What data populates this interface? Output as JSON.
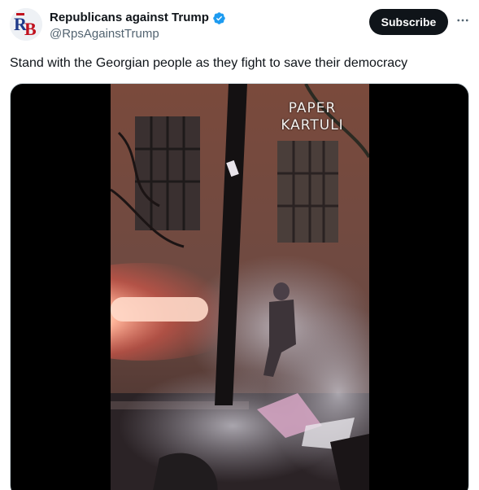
{
  "author": {
    "display_name": "Republicans against Trump",
    "handle": "@RpsAgainstTrump",
    "avatar_icon": "rb-logo-avatar",
    "verified_icon": "verified-badge-icon",
    "verified_color": "#1d9bf0"
  },
  "actions": {
    "subscribe_label": "Subscribe",
    "more_icon": "more-options-icon"
  },
  "tweet": {
    "text": "Stand with the Georgian people as they fight to save their democracy"
  },
  "media": {
    "type": "video",
    "watermark_line1": "PAPER",
    "watermark_line2": "KARTULI"
  },
  "colors": {
    "subscribe_bg": "#0f1419",
    "secondary_text": "#536471",
    "media_border": "#cfd9de"
  }
}
